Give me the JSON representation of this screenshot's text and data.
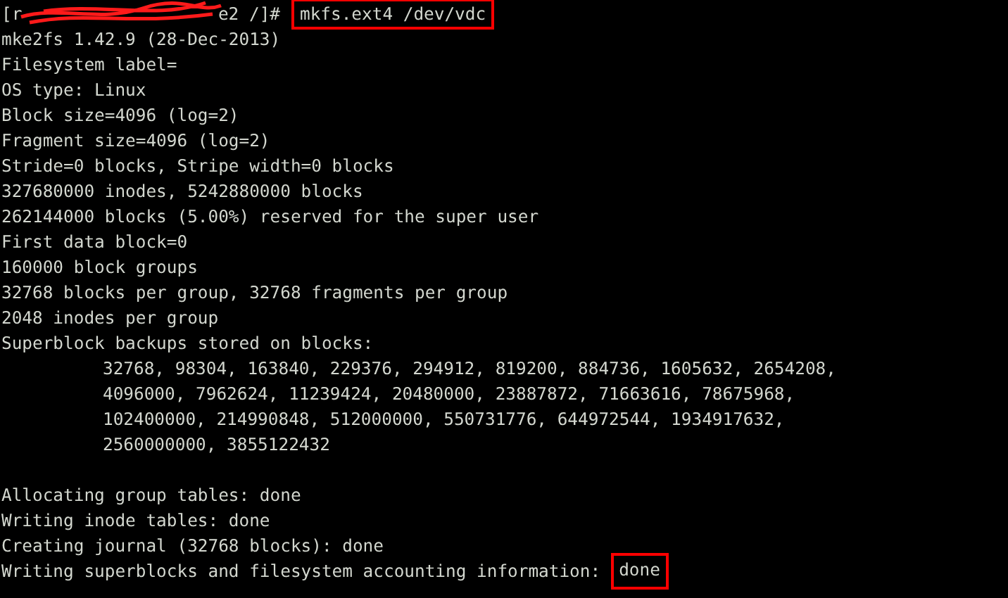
{
  "terminal": {
    "lines": [
      {
        "kind": "prompt",
        "prompt_start": "[r",
        "prompt_end": "e2 /]#",
        "command": "mkfs.ext4 /dev/vdc",
        "highlighted": true
      },
      {
        "kind": "output",
        "text": "mke2fs 1.42.9 (28-Dec-2013)"
      },
      {
        "kind": "output",
        "text": "Filesystem label="
      },
      {
        "kind": "output",
        "text": "OS type: Linux"
      },
      {
        "kind": "output",
        "text": "Block size=4096 (log=2)"
      },
      {
        "kind": "output",
        "text": "Fragment size=4096 (log=2)"
      },
      {
        "kind": "output",
        "text": "Stride=0 blocks, Stripe width=0 blocks"
      },
      {
        "kind": "output",
        "text": "327680000 inodes, 5242880000 blocks"
      },
      {
        "kind": "output",
        "text": "262144000 blocks (5.00%) reserved for the super user"
      },
      {
        "kind": "output",
        "text": "First data block=0"
      },
      {
        "kind": "output",
        "text": "160000 block groups"
      },
      {
        "kind": "output",
        "text": "32768 blocks per group, 32768 fragments per group"
      },
      {
        "kind": "output",
        "text": "2048 inodes per group"
      },
      {
        "kind": "output",
        "text": "Superblock backups stored on blocks:"
      },
      {
        "kind": "indented",
        "text": "32768, 98304, 163840, 229376, 294912, 819200, 884736, 1605632, 2654208,"
      },
      {
        "kind": "indented",
        "text": "4096000, 7962624, 11239424, 20480000, 23887872, 71663616, 78675968,"
      },
      {
        "kind": "indented",
        "text": "102400000, 214990848, 512000000, 550731776, 644972544, 1934917632,"
      },
      {
        "kind": "indented",
        "text": "2560000000, 3855122432"
      },
      {
        "kind": "blank"
      },
      {
        "kind": "output",
        "text": "Allocating group tables: done"
      },
      {
        "kind": "output",
        "text": "Writing inode tables: done"
      },
      {
        "kind": "output",
        "text": "Creating journal (32768 blocks): done"
      },
      {
        "kind": "result",
        "text": "Writing superblocks and filesystem accounting information:",
        "result": "done",
        "highlighted": true
      }
    ]
  }
}
